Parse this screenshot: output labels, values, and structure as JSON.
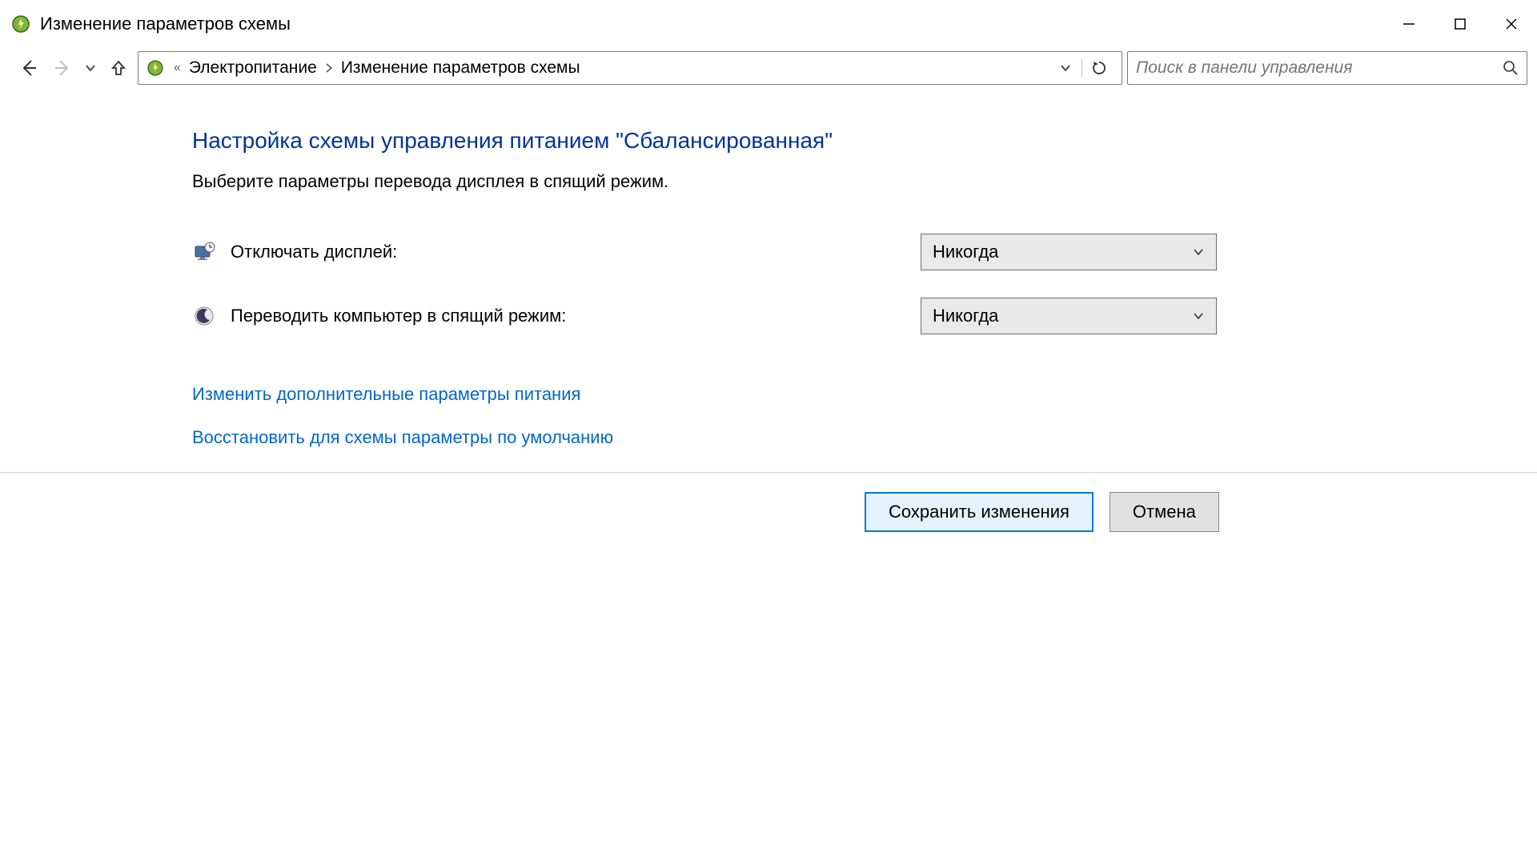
{
  "window": {
    "title": "Изменение параметров схемы"
  },
  "breadcrumb": {
    "seg1": "Электропитание",
    "seg2": "Изменение параметров схемы"
  },
  "search": {
    "placeholder": "Поиск в панели управления"
  },
  "heading": "Настройка схемы управления питанием \"Сбалансированная\"",
  "subheading": "Выберите параметры перевода дисплея в спящий режим.",
  "settings": {
    "display_off": {
      "label": "Отключать дисплей:",
      "value": "Никогда"
    },
    "sleep": {
      "label": "Переводить компьютер в спящий режим:",
      "value": "Никогда"
    }
  },
  "links": {
    "advanced": "Изменить дополнительные параметры питания",
    "restore": "Восстановить для схемы параметры по умолчанию"
  },
  "buttons": {
    "save": "Сохранить изменения",
    "cancel": "Отмена"
  }
}
